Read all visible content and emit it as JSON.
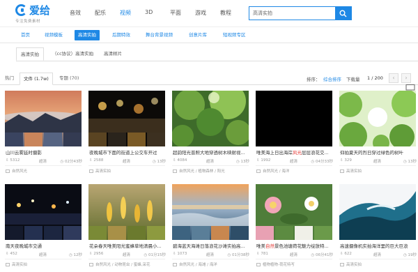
{
  "logo": {
    "name": "爱给",
    "slogan": "专注免费素材"
  },
  "topnav": [
    "音效",
    "配乐",
    "视频",
    "3D",
    "平面",
    "游戏",
    "教程"
  ],
  "topnav_active": "视频",
  "search": {
    "value": "高清实拍"
  },
  "categories": [
    "首页",
    "视频模板",
    "高清实拍",
    "后期特效",
    "舞台背景视频",
    "创意片库",
    "短视频专区"
  ],
  "category_active": "高清实拍",
  "subtabs": [
    "高清实拍",
    "（cc协议）高清实拍",
    "高清样片"
  ],
  "filter": {
    "tabs": [
      "热门",
      "文件 (1.7w)",
      "专题 (70)"
    ],
    "sort_label": "排序：",
    "sort_options": [
      "综合排序",
      "下载量"
    ],
    "page": "1 / 200",
    "prev": "‹",
    "next": "›"
  },
  "cards": [
    {
      "title": "山川云雾延时摄影",
      "downloads": "5312",
      "quality": "超清",
      "duration": "02分43秒",
      "tags": "自然风光"
    },
    {
      "title": "夜晚城市下面的街道上公交车开过",
      "downloads": "2588",
      "quality": "超清",
      "duration": "13秒",
      "tags": "高清实拍"
    },
    {
      "title": "超韵阳光普照大地穿透树木映射视...",
      "downloads": "4084",
      "quality": "超清",
      "duration": "13秒",
      "tags": "自然风光 / 植物森林 / 阳光"
    },
    {
      "title_pre": "唯美海上日出海岸",
      "title_hl": "风光",
      "title_post": "层层浪花交...",
      "downloads": "1992",
      "quality": "超清",
      "duration": "04分33秒",
      "tags": "自然风光 / 海洋"
    },
    {
      "title": "仰拍夏天的烈日穿过绿色的树叶",
      "downloads": "329",
      "quality": "超清",
      "duration": "13秒",
      "tags": "高清实拍"
    },
    {
      "title": "南天夜晚城市交通",
      "downloads": "452",
      "quality": "超清",
      "duration": "12秒",
      "tags": "高清实拍"
    },
    {
      "title": "花朵春天唯美阳光蜜蜂草地清晨小...",
      "downloads": "2956",
      "quality": "超清",
      "duration": "01分15秒",
      "tags": "自然风光 / 动物昆虫 / 蜜蜂,采花"
    },
    {
      "title": "碧海蓝天海滩日落浪花沙滩实拍高...",
      "downloads": "1073",
      "quality": "超清",
      "duration": "01分38秒",
      "tags": "自然风光 / 海滩 / 海洋"
    },
    {
      "title_pre": "唯美",
      "title_hl": "自然",
      "title_post": "景色池塘荷花魅力绽放特...",
      "downloads": "781",
      "quality": "超清",
      "duration": "06分41秒",
      "tags": "植物植物-荷花特写"
    },
    {
      "title": "高速摄像机实拍海洋里的巨大巨浪",
      "downloads": "622",
      "quality": "超清",
      "duration": "19秒",
      "tags": "高清实拍"
    }
  ]
}
